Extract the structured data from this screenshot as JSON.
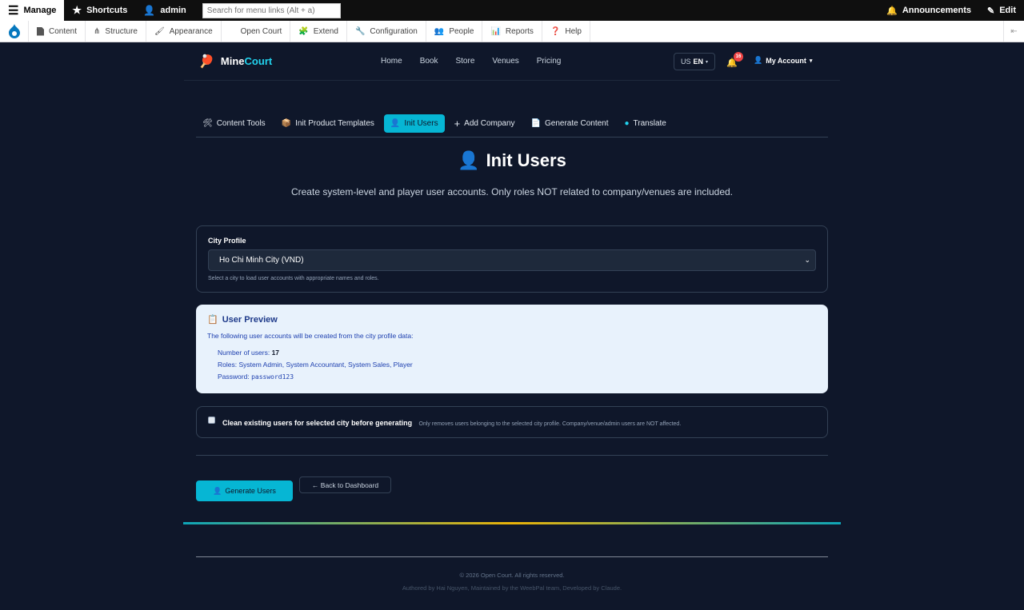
{
  "toolbar": {
    "manage": "Manage",
    "shortcuts": "Shortcuts",
    "user": "admin",
    "search_placeholder": "Search for menu links (Alt + a)",
    "announcements": "Announcements",
    "edit": "Edit"
  },
  "tray": {
    "items": [
      "Content",
      "Structure",
      "Appearance",
      "Open Court",
      "Extend",
      "Configuration",
      "People",
      "Reports",
      "Help"
    ]
  },
  "site": {
    "logo_part1": "Mine",
    "logo_part2": "Court",
    "nav": [
      "Home",
      "Book",
      "Store",
      "Venues",
      "Pricing"
    ],
    "lang_prefix": "US",
    "lang_code": "EN",
    "notifications": "16",
    "account": "My Account"
  },
  "tabs": [
    {
      "icon": "🛠",
      "label": "Content Tools"
    },
    {
      "icon": "📦",
      "label": "Init Product Templates"
    },
    {
      "icon": "👤",
      "label": "Init Users"
    },
    {
      "icon": "+",
      "label": "Add Company"
    },
    {
      "icon": "📄",
      "label": "Generate Content"
    },
    {
      "icon": "●",
      "label": "Translate"
    }
  ],
  "page": {
    "title_icon": "👤",
    "title": "Init Users",
    "subtitle": "Create system-level and player user accounts. Only roles NOT related to company/venues are included."
  },
  "city": {
    "label": "City Profile",
    "selected": "Ho Chi Minh City (VND)",
    "help": "Select a city to load user accounts with appropriate names and roles."
  },
  "preview": {
    "icon": "📋",
    "title": "User Preview",
    "intro": "The following user accounts will be created from the city profile data:",
    "count_label": "Number of users:",
    "count": "17",
    "roles": "Roles: System Admin, System Accountant, System Sales, Player",
    "password_label": "Password:",
    "password": "password123"
  },
  "clean": {
    "label": "Clean existing users for selected city before generating",
    "desc": "Only removes users belonging to the selected city profile. Company/venue/admin users are NOT affected."
  },
  "actions": {
    "generate": "Generate Users",
    "generate_icon": "👤",
    "back": "← Back to Dashboard"
  },
  "footer": {
    "copyright": "© 2026 Open Court. All rights reserved.",
    "credit": "Authored by Hai Nguyen, Maintained by the WeebPal team, Developed by Claude."
  },
  "colors": {
    "accent": "#06b6d4",
    "background": "#0f172a",
    "preview_bg": "#e8f2fc"
  }
}
